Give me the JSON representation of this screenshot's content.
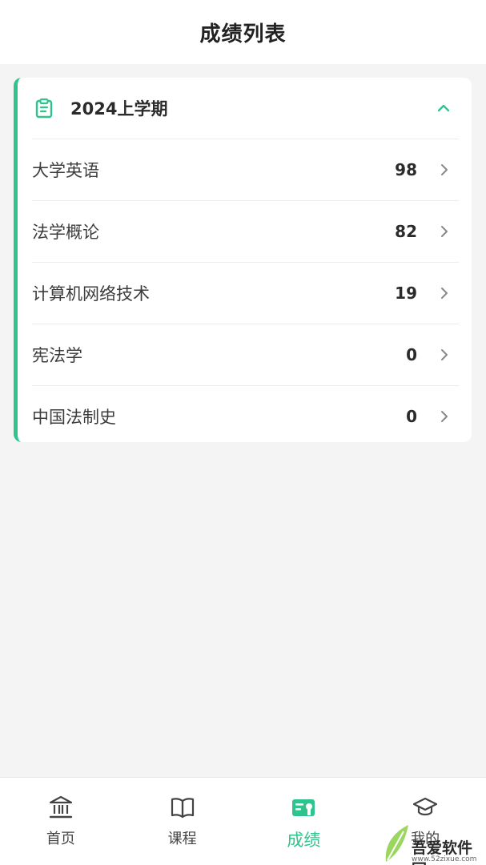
{
  "header": {
    "title": "成绩列表"
  },
  "semester": {
    "name": "2024上学期",
    "courses": [
      {
        "name": "大学英语",
        "score": "98"
      },
      {
        "name": "法学概论",
        "score": "82"
      },
      {
        "name": "计算机网络技术",
        "score": "19"
      },
      {
        "name": "宪法学",
        "score": "0"
      },
      {
        "name": "中国法制史",
        "score": "0"
      }
    ]
  },
  "bottom_nav": {
    "items": [
      {
        "label": "首页",
        "icon": "bank-icon"
      },
      {
        "label": "课程",
        "icon": "book-icon"
      },
      {
        "label": "成绩",
        "icon": "grade-card-icon",
        "active": true
      },
      {
        "label": "我的",
        "icon": "graduation-cap-icon"
      }
    ]
  },
  "watermark": {
    "text": "吾爱软件园",
    "url": "www.52zixue.com"
  },
  "colors": {
    "accent": "#2fc48d",
    "background": "#f4f4f4",
    "card": "#ffffff"
  }
}
